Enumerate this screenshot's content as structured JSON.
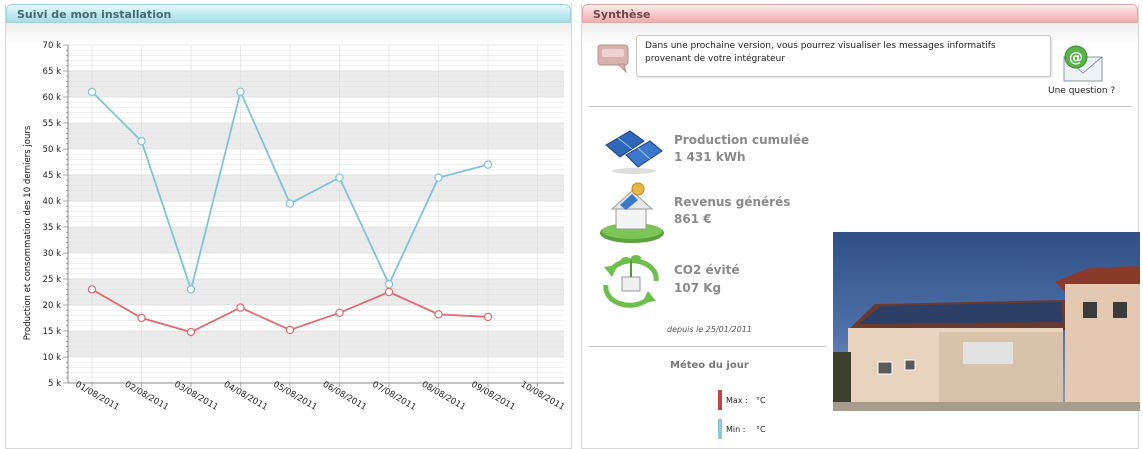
{
  "left_panel": {
    "title": "Suivi de mon installation"
  },
  "right_panel": {
    "title": "Synthèse"
  },
  "chart_data": {
    "type": "line",
    "ylabel": "Production et consommation des 10 derniers jours",
    "categories": [
      "01/08/2011",
      "02/08/2011",
      "03/08/2011",
      "04/08/2011",
      "05/08/2011",
      "06/08/2011",
      "07/08/2011",
      "08/08/2011",
      "09/08/2011",
      "10/08/2011"
    ],
    "y_ticks": [
      "5 k",
      "10 k",
      "15 k",
      "20 k",
      "25 k",
      "30 k",
      "35 k",
      "40 k",
      "45 k",
      "50 k",
      "55 k",
      "60 k",
      "65 k",
      "70 k"
    ],
    "ylim": [
      5000,
      70000
    ],
    "grid": true,
    "series": [
      {
        "color": "#7fc4d6",
        "values": [
          61000,
          51500,
          23000,
          61000,
          39500,
          44500,
          24000,
          44500,
          47000,
          null
        ]
      },
      {
        "color": "#e06a72",
        "values": [
          23000,
          17500,
          14800,
          19500,
          15200,
          18500,
          22500,
          18200,
          17700,
          null
        ]
      }
    ]
  },
  "synthese": {
    "message": "Dans une prochaine version, vous pourrez visualiser les messages informatifs provenant de votre intégrateur",
    "question_label": "Une question ?",
    "stats": [
      {
        "icon": "solar-panels-icon",
        "title": "Production cumulée",
        "value": "1 431 kWh"
      },
      {
        "icon": "house-coins-icon",
        "title": "Revenus générés",
        "value": "861 €"
      },
      {
        "icon": "recycle-plant-icon",
        "title": "CO2 évité",
        "value": "107 Kg"
      }
    ],
    "since": "depuis le 25/01/2011",
    "weather": {
      "title": "Méteo du jour",
      "max_label": "Max :",
      "max_unit": "°C",
      "min_label": "Min :",
      "min_unit": "°C",
      "max_color": "#c94045",
      "min_color": "#8cc7dc"
    }
  }
}
